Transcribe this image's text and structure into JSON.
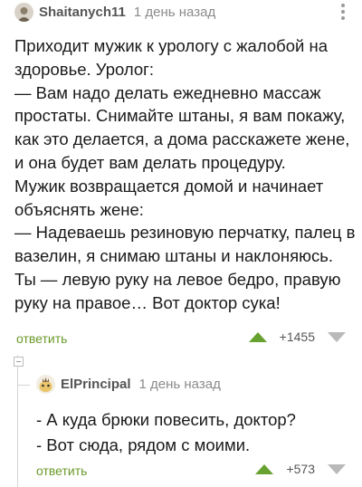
{
  "comments": [
    {
      "username": "Shaitanych11",
      "timestamp": "1 день назад",
      "lines": [
        "Приходит мужик к урологу с жалобой на",
        "здоровье. Уролог:",
        "— Вам надо делать ежедневно массаж",
        "простаты. Снимайте штаны, я вам покажу,",
        "как это делается, а дома расскажете жене,",
        "и она будет вам делать процедуру.",
        "Мужик возвращается домой и начинает",
        "объяснять жене:",
        "— Надеваешь резиновую перчатку, палец в",
        "вазелин, я снимаю штаны и наклоняюсь.",
        "Ты — левую руку на левое бедро, правую",
        "руку на правое… Вот доктор сука!"
      ],
      "reply_label": "ответить",
      "rating": "+1455",
      "avatar_icon": "user-avatar-icon"
    },
    {
      "username": "ElPrincipal",
      "timestamp": "1 день назад",
      "lines": [
        "- А куда брюки повесить, доктор?",
        "- Вот сюда, рядом с моими."
      ],
      "reply_label": "ответить",
      "rating": "+573",
      "avatar_icon": "user-avatar-icon"
    }
  ],
  "colors": {
    "accent_green": "#67a12f",
    "reply_green": "#6a9a2a",
    "muted": "#8b8b8b"
  },
  "icons": {
    "more": "more-vertical-icon",
    "upvote": "upvote-arrow-icon",
    "downvote": "downvote-arrow-icon",
    "collapse": "collapse-thread-icon"
  }
}
